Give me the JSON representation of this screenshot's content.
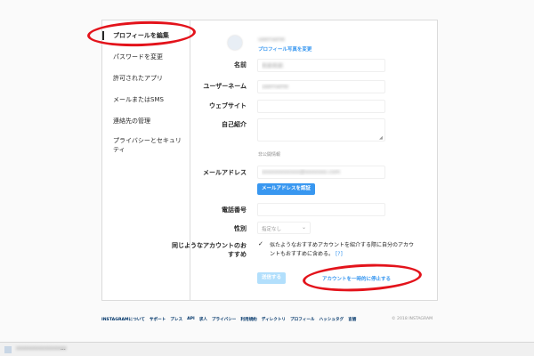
{
  "sidebar": {
    "items": [
      {
        "label": "プロフィールを編集"
      },
      {
        "label": "パスワードを変更"
      },
      {
        "label": "許可されたアプリ"
      },
      {
        "label": "メールまたはSMS"
      },
      {
        "label": "連絡先の管理"
      },
      {
        "label": "プライバシーとセキュリティ"
      }
    ]
  },
  "profile": {
    "username_display": "username",
    "change_photo_link": "プロフィール写真を変更"
  },
  "form": {
    "name_label": "名前",
    "name_value": "名前名前",
    "username_label": "ユーザーネーム",
    "username_value": "username",
    "website_label": "ウェブサイト",
    "website_value": "",
    "bio_label": "自己紹介",
    "bio_value": "",
    "private_info_heading": "非公開情報",
    "email_label": "メールアドレス",
    "email_value": "xxxxxxxxxxxx@xxxxxxx.com",
    "confirm_email_button": "メールアドレスを認証",
    "phone_label": "電話番号",
    "phone_value": "",
    "gender_label": "性別",
    "gender_selected": "指定なし",
    "similar_accounts_label": "同じようなアカウントのおすすめ",
    "similar_accounts_text": "似たようなおすすめアカウントを紹介する際に自分のアカウントもおすすめに含める。",
    "help_link": "[?]",
    "submit_button": "送信する",
    "disable_account_link": "アカウントを一時的に停止する"
  },
  "footer": {
    "links": [
      "INSTAGRAMについて",
      "サポート",
      "プレス",
      "API",
      "求人",
      "プライバシー",
      "利用規約",
      "ディレクトリ",
      "プロフィール",
      "ハッシュタグ",
      "言語"
    ],
    "copyright": "© 2018 INSTAGRAM"
  },
  "taskbar": {
    "blurred_text": "xxxxxxxxxxxxxxxx",
    "ellipsis": "..."
  },
  "colors": {
    "accent": "#3897f0",
    "annotation": "#e3131b",
    "footer_link": "#003569"
  }
}
